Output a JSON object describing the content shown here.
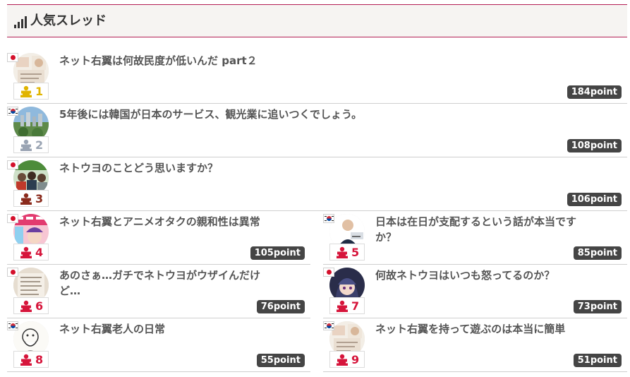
{
  "header": {
    "title": "人気スレッド",
    "icon": "signal-bars-icon"
  },
  "colors": {
    "accent": "#b31d53",
    "gold": "#e0b400",
    "silver": "#9aa4b3",
    "bronze": "#8a2a1c",
    "red": "#d6153b",
    "badge": "#454545"
  },
  "threads": [
    {
      "rank": "1",
      "title": "ネット右翼は何故民度が低いんだ part２",
      "points": "184point",
      "flag": "jp",
      "medal": "gold"
    },
    {
      "rank": "2",
      "title": "5年後には韓国が日本のサービス、観光業に追いつくでしょう。",
      "points": "108point",
      "flag": "kr",
      "medal": "silver"
    },
    {
      "rank": "3",
      "title": "ネトウヨのことどう思いますか？",
      "points": "106point",
      "flag": "jp",
      "medal": "bronze"
    },
    {
      "rank": "4",
      "title": "ネット右翼とアニメオタクの親和性は異常",
      "points": "105point",
      "flag": "jp",
      "medal": "red"
    },
    {
      "rank": "5",
      "title": "日本は在日が支配するという話が本当ですか？",
      "points": "85point",
      "flag": "kr",
      "medal": "red"
    },
    {
      "rank": "6",
      "title": "あのさぁ…ガチでネトウヨがウザイんだけど…",
      "points": "76point",
      "flag": "jp",
      "medal": "red"
    },
    {
      "rank": "7",
      "title": "何故ネトウヨはいつも怒ってるのか？",
      "points": "73point",
      "flag": "jp",
      "medal": "red"
    },
    {
      "rank": "8",
      "title": "ネット右翼老人の日常",
      "points": "55point",
      "flag": "kr",
      "medal": "red"
    },
    {
      "rank": "9",
      "title": "ネット右翼を持って遊ぶのは本当に簡単",
      "points": "51point",
      "flag": "kr",
      "medal": "red"
    }
  ]
}
